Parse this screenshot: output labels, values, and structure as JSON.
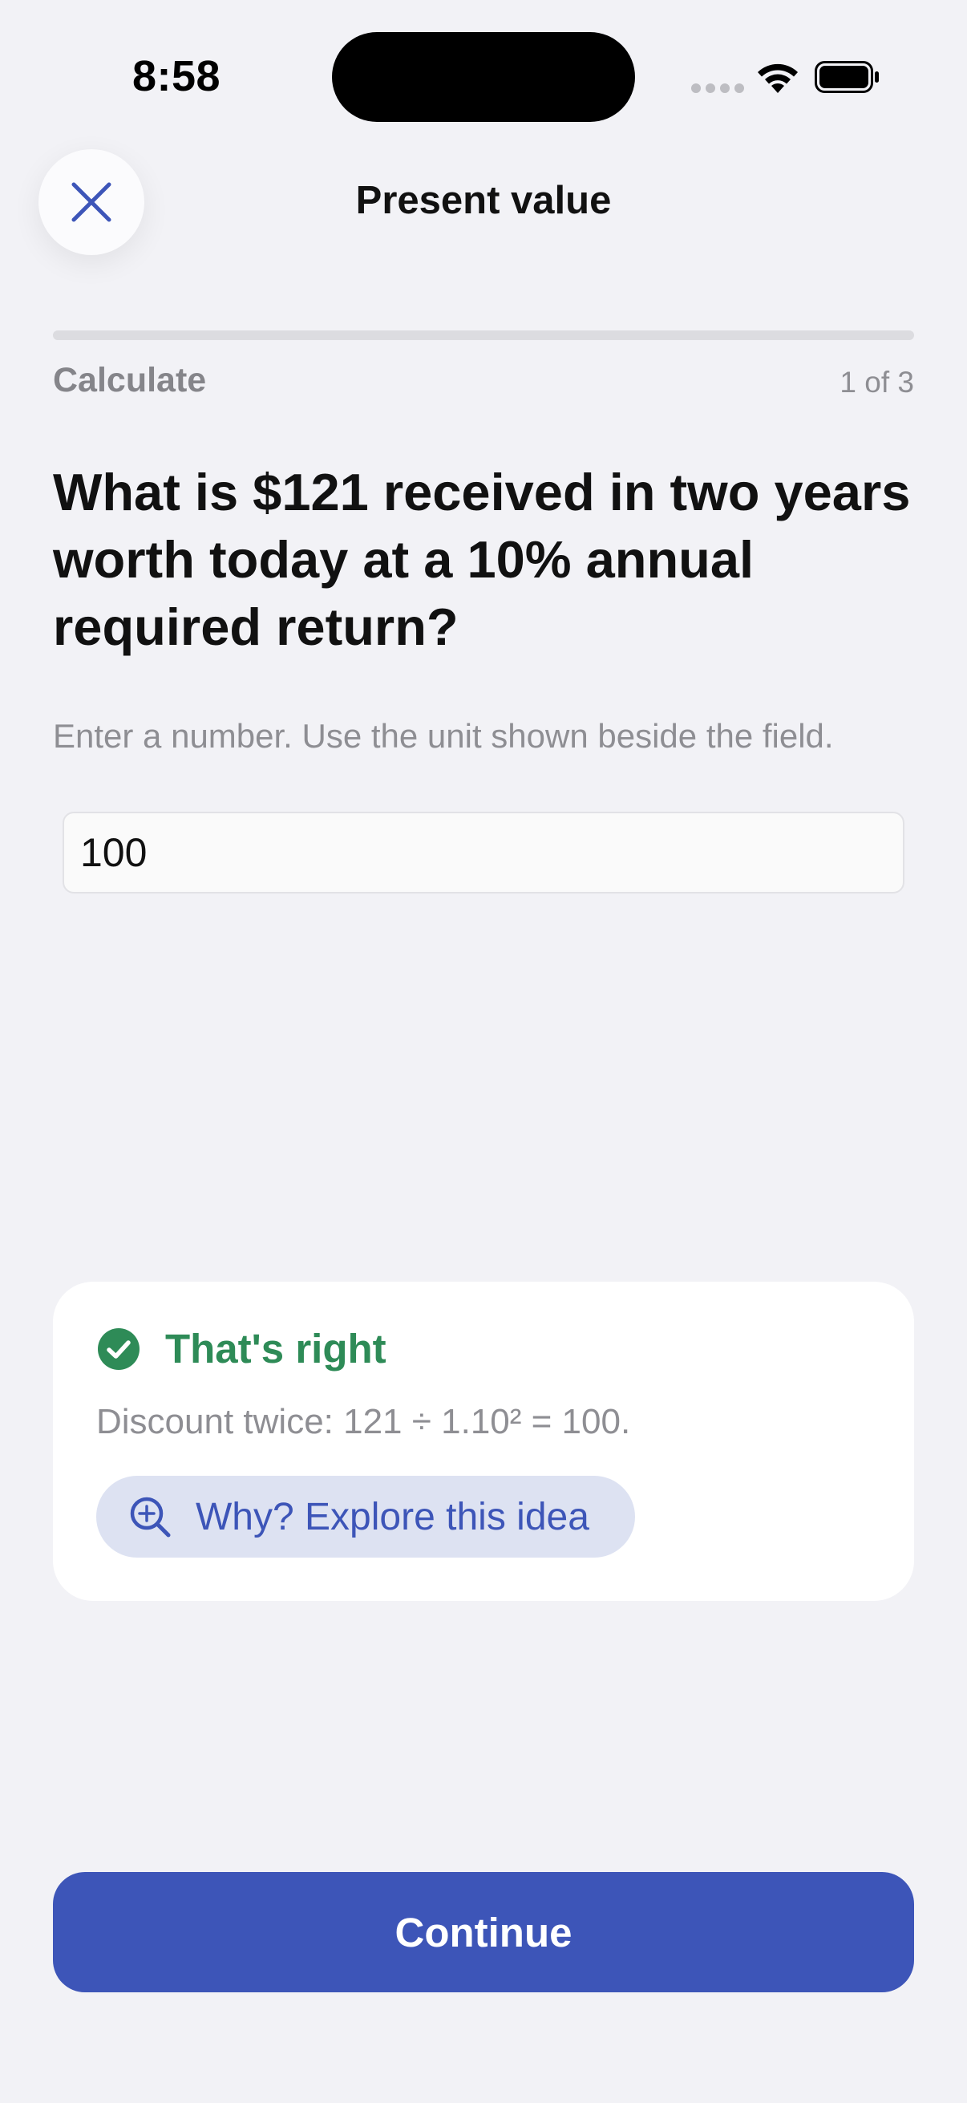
{
  "status_bar": {
    "time": "8:58"
  },
  "header": {
    "title": "Present value",
    "close_icon": "close-icon"
  },
  "progress": {
    "step_label": "Calculate",
    "step_count": "1 of 3",
    "fraction": 0
  },
  "question": {
    "text": "What is $121 received in two years worth today at a 10% annual required return?",
    "instructions": "Enter a number. Use the unit shown beside the field.",
    "answer_value": "100"
  },
  "feedback": {
    "icon": "check-circle-icon",
    "title": "That's right",
    "body": "Discount twice: 121 ÷ 1.10² = 100.",
    "explore_icon": "zoom-in-icon",
    "explore_label": "Why? Explore this idea"
  },
  "footer": {
    "continue_label": "Continue"
  },
  "colors": {
    "background": "#F2F2F6",
    "accent": "#3D55B8",
    "success": "#2E8B57",
    "muted_text": "#8E8E93",
    "explore_bg": "#DDE2F2"
  }
}
